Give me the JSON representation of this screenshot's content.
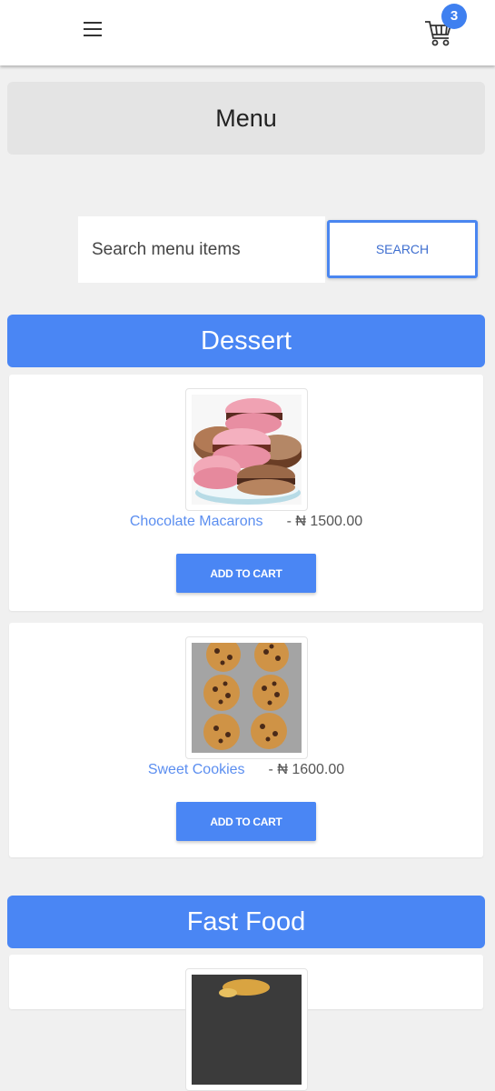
{
  "header": {
    "cart_count": "3"
  },
  "page": {
    "title": "Menu"
  },
  "search": {
    "placeholder": "Search menu items",
    "button_label": "SEARCH"
  },
  "categories": [
    {
      "name": "Dessert",
      "items": [
        {
          "name": "Chocolate Macarons",
          "price": "- ₦ 1500.00",
          "button_label": "ADD TO CART"
        },
        {
          "name": "Sweet Cookies",
          "price": "- ₦ 1600.00",
          "button_label": "ADD TO CART"
        }
      ]
    },
    {
      "name": "Fast Food",
      "items": []
    }
  ],
  "colors": {
    "accent": "#4a86f4",
    "link": "#5b8ef0",
    "background": "#f0f0f0"
  }
}
